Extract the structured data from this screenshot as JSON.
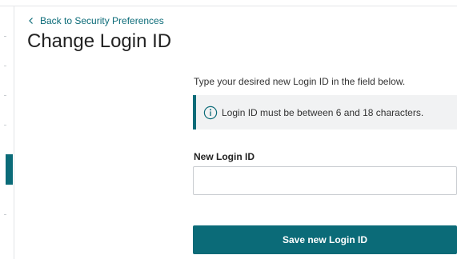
{
  "navigation": {
    "back_link_label": "Back to Security Preferences"
  },
  "page": {
    "title": "Change Login ID"
  },
  "form": {
    "instruction": "Type your desired new Login ID in the field below.",
    "info_message": "Login ID must be between 6 and 18 characters.",
    "field_label": "New Login ID",
    "field_value": "",
    "field_placeholder": "",
    "submit_label": "Save new Login ID"
  },
  "icons": {
    "back": "chevron-left-icon",
    "info": "info-circle-icon"
  },
  "colors": {
    "accent": "#0b6b78",
    "info_background": "#f1f2f3",
    "button_text": "#ffffff"
  }
}
